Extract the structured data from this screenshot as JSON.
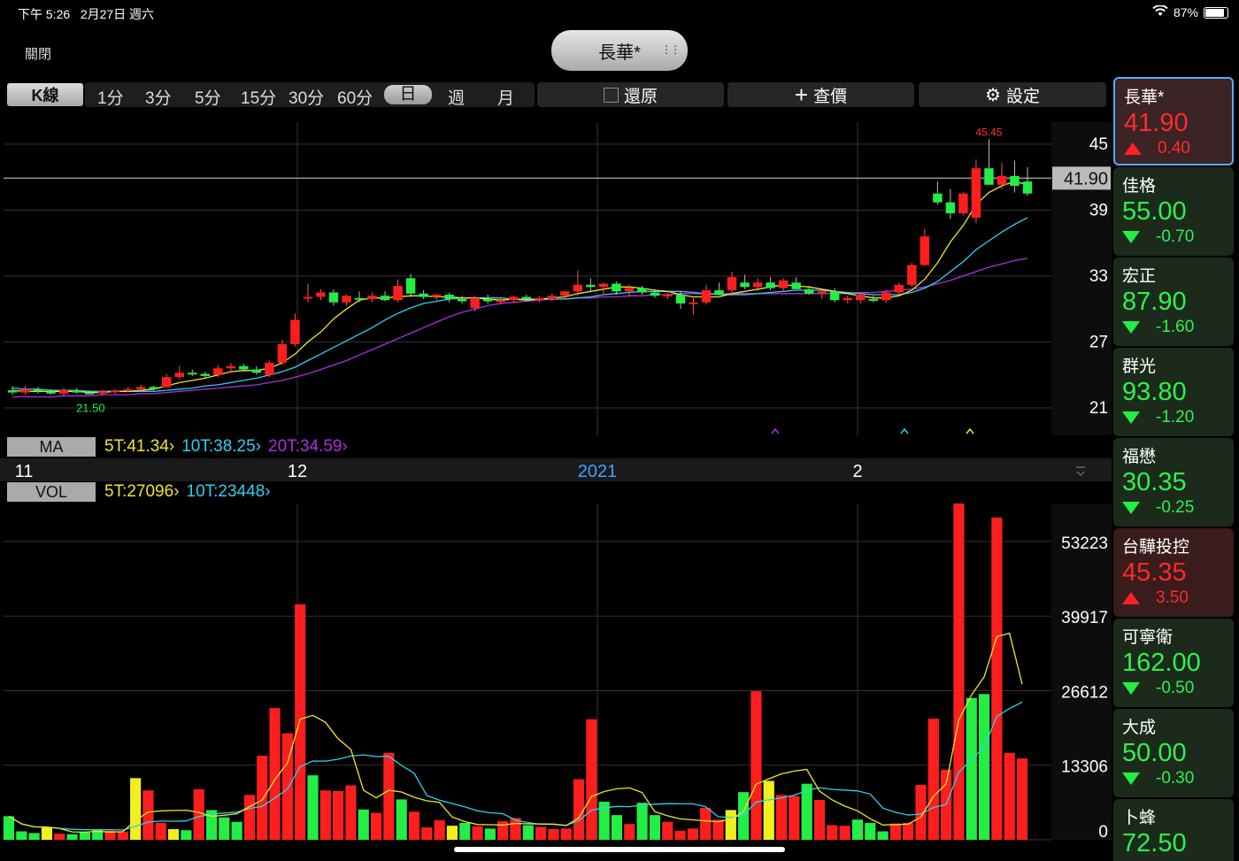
{
  "status": {
    "time": "下午 5:26",
    "date": "2月27日 週六",
    "battery": "87%",
    "battery_level": 0.87
  },
  "nav": {
    "close": "關閉",
    "title": "長華*"
  },
  "toolbar": {
    "kline": "K線",
    "periods": [
      "1分",
      "3分",
      "5分",
      "15分",
      "30分",
      "60分",
      "日",
      "週",
      "月"
    ],
    "active_period": "日",
    "restore": "還原",
    "query": "查價",
    "settings": "設定"
  },
  "price_panel": {
    "y_ticks": [
      "45",
      "39",
      "33",
      "27",
      "21"
    ],
    "current_price": "41.90",
    "high_label": "45.45",
    "low_label": "21.50",
    "ma_label": "MA",
    "ma_legend": [
      {
        "text": "5T:41.34",
        "color": "#f0e62a"
      },
      {
        "text": "10T:38.25",
        "color": "#2fd0f0"
      },
      {
        "text": "20T:34.59",
        "color": "#b02ee0"
      }
    ]
  },
  "date_axis": [
    "11",
    "12",
    "2021",
    "2"
  ],
  "volume_panel": {
    "label": "VOL",
    "y_ticks": [
      "53223",
      "39917",
      "26612",
      "13306",
      "0"
    ],
    "legend": [
      {
        "text": "5T:27096",
        "color": "#f0e62a"
      },
      {
        "text": "10T:23448",
        "color": "#2fd0f0"
      }
    ]
  },
  "chart_data": {
    "type": "candlestick",
    "price_ylim": [
      18.5,
      47
    ],
    "volume_ylim": [
      0,
      60000
    ],
    "candles": [
      [
        22.6,
        23.0,
        22.2,
        22.4
      ],
      [
        22.4,
        23.0,
        22.2,
        22.7
      ],
      [
        22.7,
        22.9,
        22.3,
        22.5
      ],
      [
        22.5,
        22.7,
        22.2,
        22.3
      ],
      [
        22.3,
        22.8,
        22.1,
        22.6
      ],
      [
        22.6,
        22.8,
        22.3,
        22.4
      ],
      [
        22.4,
        22.6,
        22.2,
        22.3
      ],
      [
        22.3,
        22.6,
        22.1,
        22.5
      ],
      [
        22.5,
        22.7,
        22.3,
        22.6
      ],
      [
        22.6,
        22.9,
        22.4,
        22.7
      ],
      [
        22.7,
        23.1,
        22.5,
        22.9
      ],
      [
        22.9,
        23.0,
        22.6,
        22.7
      ],
      [
        22.9,
        24.1,
        22.8,
        23.8
      ],
      [
        23.8,
        24.8,
        23.6,
        24.2
      ],
      [
        24.2,
        24.5,
        23.9,
        24.1
      ],
      [
        24.1,
        24.3,
        23.7,
        23.9
      ],
      [
        24.0,
        24.9,
        23.8,
        24.6
      ],
      [
        24.6,
        25.1,
        24.3,
        24.8
      ],
      [
        24.8,
        25.0,
        24.3,
        24.5
      ],
      [
        24.5,
        24.8,
        24.0,
        24.2
      ],
      [
        24.0,
        25.3,
        23.8,
        25.1
      ],
      [
        25.1,
        27.2,
        24.9,
        26.8
      ],
      [
        26.8,
        29.6,
        26.6,
        29.0
      ],
      [
        31.0,
        32.3,
        30.6,
        31.1
      ],
      [
        31.1,
        31.8,
        30.8,
        31.5
      ],
      [
        31.5,
        31.8,
        30.3,
        30.6
      ],
      [
        30.6,
        31.3,
        30.3,
        31.2
      ],
      [
        31.0,
        31.6,
        30.6,
        30.9
      ],
      [
        30.9,
        31.5,
        30.6,
        31.2
      ],
      [
        31.2,
        31.6,
        30.7,
        30.8
      ],
      [
        30.8,
        32.7,
        30.6,
        32.1
      ],
      [
        32.8,
        33.2,
        31.1,
        31.4
      ],
      [
        31.4,
        31.7,
        30.9,
        31.1
      ],
      [
        31.1,
        31.4,
        30.8,
        31.3
      ],
      [
        31.3,
        31.5,
        30.6,
        30.9
      ],
      [
        30.9,
        31.2,
        30.5,
        30.7
      ],
      [
        30.1,
        31.2,
        29.8,
        31.0
      ],
      [
        30.9,
        31.3,
        30.5,
        30.7
      ],
      [
        30.7,
        31.0,
        30.4,
        30.8
      ],
      [
        30.8,
        31.2,
        30.6,
        31.1
      ],
      [
        31.1,
        31.3,
        30.7,
        30.9
      ],
      [
        30.9,
        31.2,
        30.6,
        31.0
      ],
      [
        30.9,
        31.4,
        30.7,
        31.2
      ],
      [
        31.2,
        31.6,
        30.9,
        31.6
      ],
      [
        31.6,
        33.5,
        31.2,
        32.2
      ],
      [
        32.2,
        32.8,
        31.5,
        32.0
      ],
      [
        32.0,
        32.4,
        31.4,
        32.3
      ],
      [
        32.3,
        32.5,
        31.3,
        31.6
      ],
      [
        31.6,
        32.2,
        31.1,
        31.9
      ],
      [
        31.9,
        32.1,
        31.3,
        31.5
      ],
      [
        31.5,
        31.8,
        31.0,
        31.2
      ],
      [
        31.2,
        31.5,
        30.9,
        31.3
      ],
      [
        31.3,
        31.6,
        30.0,
        30.5
      ],
      [
        30.5,
        31.0,
        29.5,
        30.6
      ],
      [
        30.6,
        32.2,
        30.4,
        31.7
      ],
      [
        31.7,
        32.4,
        31.3,
        31.3
      ],
      [
        31.7,
        33.4,
        31.2,
        32.9
      ],
      [
        32.4,
        33.1,
        31.8,
        32.0
      ],
      [
        32.0,
        32.8,
        31.6,
        32.4
      ],
      [
        32.4,
        32.9,
        31.7,
        31.9
      ],
      [
        31.9,
        32.8,
        31.6,
        32.6
      ],
      [
        32.4,
        32.9,
        31.8,
        31.8
      ],
      [
        31.8,
        32.1,
        31.3,
        31.4
      ],
      [
        31.4,
        31.8,
        30.9,
        31.6
      ],
      [
        31.6,
        31.9,
        30.6,
        30.8
      ],
      [
        30.8,
        31.2,
        30.5,
        31.0
      ],
      [
        30.8,
        31.5,
        30.5,
        31.3
      ],
      [
        30.9,
        31.2,
        30.6,
        30.8
      ],
      [
        30.8,
        31.7,
        30.6,
        31.5
      ],
      [
        31.5,
        32.4,
        31.3,
        32.2
      ],
      [
        32.2,
        34.2,
        32.0,
        34.0
      ],
      [
        34.0,
        37.3,
        33.9,
        36.6
      ],
      [
        40.5,
        41.6,
        39.5,
        39.7
      ],
      [
        39.7,
        40.9,
        38.2,
        38.7
      ],
      [
        38.7,
        40.6,
        38.5,
        40.5
      ],
      [
        38.3,
        43.6,
        37.8,
        42.8
      ],
      [
        42.8,
        45.45,
        42.1,
        41.3
      ],
      [
        41.3,
        43.3,
        40.9,
        42.1
      ],
      [
        42.1,
        43.5,
        40.6,
        41.2
      ],
      [
        41.6,
        42.9,
        40.3,
        40.5
      ]
    ],
    "ma5": [
      22.6,
      22.5,
      22.5,
      22.5,
      22.5,
      22.5,
      22.4,
      22.4,
      22.5,
      22.5,
      22.6,
      22.7,
      23.0,
      23.3,
      23.5,
      23.7,
      24.0,
      24.3,
      24.4,
      24.4,
      24.6,
      25.1,
      25.9,
      27.0,
      27.9,
      29.1,
      30.0,
      30.8,
      31.0,
      31.0,
      31.1,
      31.2,
      31.2,
      31.1,
      31.1,
      31.0,
      31.0,
      30.9,
      30.8,
      30.9,
      30.8,
      30.9,
      31.0,
      31.1,
      31.4,
      31.6,
      31.8,
      32.0,
      32.0,
      31.9,
      31.7,
      31.6,
      31.3,
      31.1,
      31.1,
      31.1,
      31.4,
      31.6,
      31.8,
      32.0,
      32.2,
      32.1,
      32.0,
      31.8,
      31.6,
      31.4,
      31.2,
      31.0,
      31.0,
      31.2,
      31.7,
      32.7,
      34.2,
      36.1,
      37.6,
      39.5,
      40.6,
      41.2,
      41.6,
      41.3
    ],
    "ma10": [
      22.8,
      22.7,
      22.7,
      22.6,
      22.6,
      22.6,
      22.5,
      22.5,
      22.5,
      22.5,
      22.5,
      22.5,
      22.6,
      22.7,
      22.8,
      23.0,
      23.1,
      23.3,
      23.5,
      23.7,
      24.0,
      24.3,
      24.7,
      25.3,
      25.9,
      26.5,
      27.1,
      27.7,
      28.3,
      29.0,
      29.6,
      30.1,
      30.5,
      30.7,
      30.9,
      31.0,
      31.0,
      31.0,
      31.0,
      30.9,
      30.9,
      30.9,
      30.9,
      30.9,
      31.0,
      31.1,
      31.3,
      31.4,
      31.5,
      31.6,
      31.6,
      31.6,
      31.6,
      31.5,
      31.4,
      31.3,
      31.3,
      31.3,
      31.4,
      31.5,
      31.6,
      31.7,
      31.7,
      31.7,
      31.6,
      31.5,
      31.4,
      31.3,
      31.3,
      31.3,
      31.5,
      31.9,
      32.5,
      33.4,
      34.3,
      35.4,
      36.2,
      37.0,
      37.7,
      38.3
    ],
    "ma20": [
      22.0,
      22.0,
      22.0,
      22.0,
      22.1,
      22.1,
      22.1,
      22.2,
      22.2,
      22.2,
      22.3,
      22.3,
      22.4,
      22.5,
      22.6,
      22.7,
      22.8,
      22.9,
      23.0,
      23.1,
      23.3,
      23.5,
      23.8,
      24.1,
      24.5,
      24.9,
      25.3,
      25.8,
      26.3,
      26.8,
      27.3,
      27.8,
      28.3,
      28.8,
      29.3,
      29.7,
      30.0,
      30.3,
      30.5,
      30.6,
      30.7,
      30.8,
      30.9,
      30.9,
      31.0,
      31.0,
      31.1,
      31.1,
      31.2,
      31.2,
      31.3,
      31.3,
      31.4,
      31.4,
      31.4,
      31.4,
      31.4,
      31.4,
      31.4,
      31.4,
      31.4,
      31.4,
      31.4,
      31.4,
      31.4,
      31.4,
      31.5,
      31.5,
      31.6,
      31.7,
      31.8,
      32.0,
      32.3,
      32.6,
      33.0,
      33.4,
      33.8,
      34.1,
      34.4,
      34.6
    ],
    "volume": [
      4200,
      1500,
      1200,
      2200,
      1100,
      1000,
      1300,
      1900,
      1600,
      1400,
      11000,
      8800,
      3000,
      1900,
      1700,
      9000,
      5300,
      4000,
      3200,
      8000,
      15000,
      23500,
      19000,
      42000,
      11500,
      8800,
      8700,
      9700,
      5400,
      4800,
      15500,
      7200,
      5000,
      2200,
      3500,
      2500,
      3000,
      2400,
      2000,
      3300,
      3900,
      2600,
      2300,
      1900,
      2000,
      10800,
      21500,
      6800,
      4400,
      2800,
      6600,
      4400,
      3200,
      1600,
      2000,
      5700,
      3600,
      5300,
      8500,
      26500,
      10500,
      8000,
      7800,
      10000,
      7100,
      2600,
      2500,
      3600,
      3000,
      1500,
      2900,
      3000,
      9800,
      21600,
      12500,
      60000,
      25300,
      26000,
      57500,
      15500,
      14500
    ],
    "volume_colors": [
      "g",
      "g",
      "g",
      "y",
      "r",
      "g",
      "g",
      "g",
      "r",
      "r",
      "y",
      "r",
      "r",
      "y",
      "g",
      "r",
      "g",
      "g",
      "g",
      "r",
      "r",
      "r",
      "r",
      "r",
      "g",
      "r",
      "r",
      "r",
      "g",
      "r",
      "r",
      "g",
      "r",
      "r",
      "r",
      "y",
      "g",
      "r",
      "g",
      "r",
      "r",
      "g",
      "r",
      "r",
      "r",
      "r",
      "r",
      "g",
      "g",
      "r",
      "g",
      "g",
      "r",
      "r",
      "r",
      "r",
      "r",
      "y",
      "g",
      "r",
      "y",
      "r",
      "r",
      "g",
      "r",
      "r",
      "r",
      "g",
      "g",
      "g",
      "r",
      "r",
      "r",
      "r",
      "r",
      "r",
      "g",
      "g",
      "r",
      "r",
      "r"
    ]
  },
  "watchlist": [
    {
      "name": "長華*",
      "price": "41.90",
      "change": "0.40",
      "dir": "up",
      "selected": true
    },
    {
      "name": "佳格",
      "price": "55.00",
      "change": "-0.70",
      "dir": "down"
    },
    {
      "name": "宏正",
      "price": "87.90",
      "change": "-1.60",
      "dir": "down"
    },
    {
      "name": "群光",
      "price": "93.80",
      "change": "-1.20",
      "dir": "down"
    },
    {
      "name": "福懋",
      "price": "30.35",
      "change": "-0.25",
      "dir": "down"
    },
    {
      "name": "台驊投控",
      "price": "45.35",
      "change": "3.50",
      "dir": "up"
    },
    {
      "name": "可寧衛",
      "price": "162.00",
      "change": "-0.50",
      "dir": "down"
    },
    {
      "name": "大成",
      "price": "50.00",
      "change": "-0.30",
      "dir": "down"
    },
    {
      "name": "卜蜂",
      "price": "72.50",
      "change": "",
      "dir": "down"
    }
  ]
}
